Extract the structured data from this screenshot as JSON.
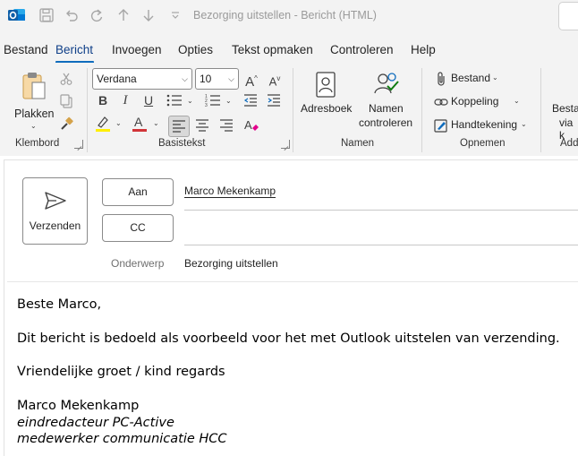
{
  "window": {
    "title": "Bezorging uitstellen  -  Bericht (HTML)"
  },
  "menu": {
    "tabs": [
      "Bestand",
      "Bericht",
      "Invoegen",
      "Opties",
      "Tekst opmaken",
      "Controleren",
      "Help"
    ],
    "active": "Bericht"
  },
  "ribbon": {
    "klembord": {
      "group_label": "Klembord",
      "paste_label": "Plakken"
    },
    "basistekst": {
      "group_label": "Basistekst",
      "font": "Verdana",
      "size": "10",
      "bold": "B",
      "italic": "I",
      "underline": "U",
      "highlight_color": "#ffef00",
      "font_color": "#d13438"
    },
    "namen": {
      "group_label": "Namen",
      "adresboek": "Adresboek",
      "namen_controleren_1": "Namen",
      "namen_controleren_2": "controleren"
    },
    "opnemen": {
      "group_label": "Opnemen",
      "bestand": "Bestand",
      "koppeling": "Koppeling",
      "handtekening": "Handtekening"
    },
    "partial": {
      "line1": "Besta",
      "line2": "via k",
      "group_label": "Add"
    }
  },
  "compose": {
    "send_label": "Verzenden",
    "to_button": "Aan",
    "cc_button": "CC",
    "to_value": "Marco Mekenkamp",
    "cc_value": "",
    "subject_label": "Onderwerp",
    "subject_value": "Bezorging uitstellen"
  },
  "body": {
    "greeting": "Beste Marco,",
    "text": "Dit bericht is bedoeld als voorbeeld voor het met Outlook uitstelen van verzending.",
    "closing": "Vriendelijke groet / kind regards",
    "signature_name": "Marco Mekenkamp",
    "signature_role1": "eindredacteur PC-Active",
    "signature_role2": "medewerker communicatie HCC"
  },
  "colors": {
    "accent": "#0f6cbd",
    "outlook_blue": "#0f6cbd"
  }
}
